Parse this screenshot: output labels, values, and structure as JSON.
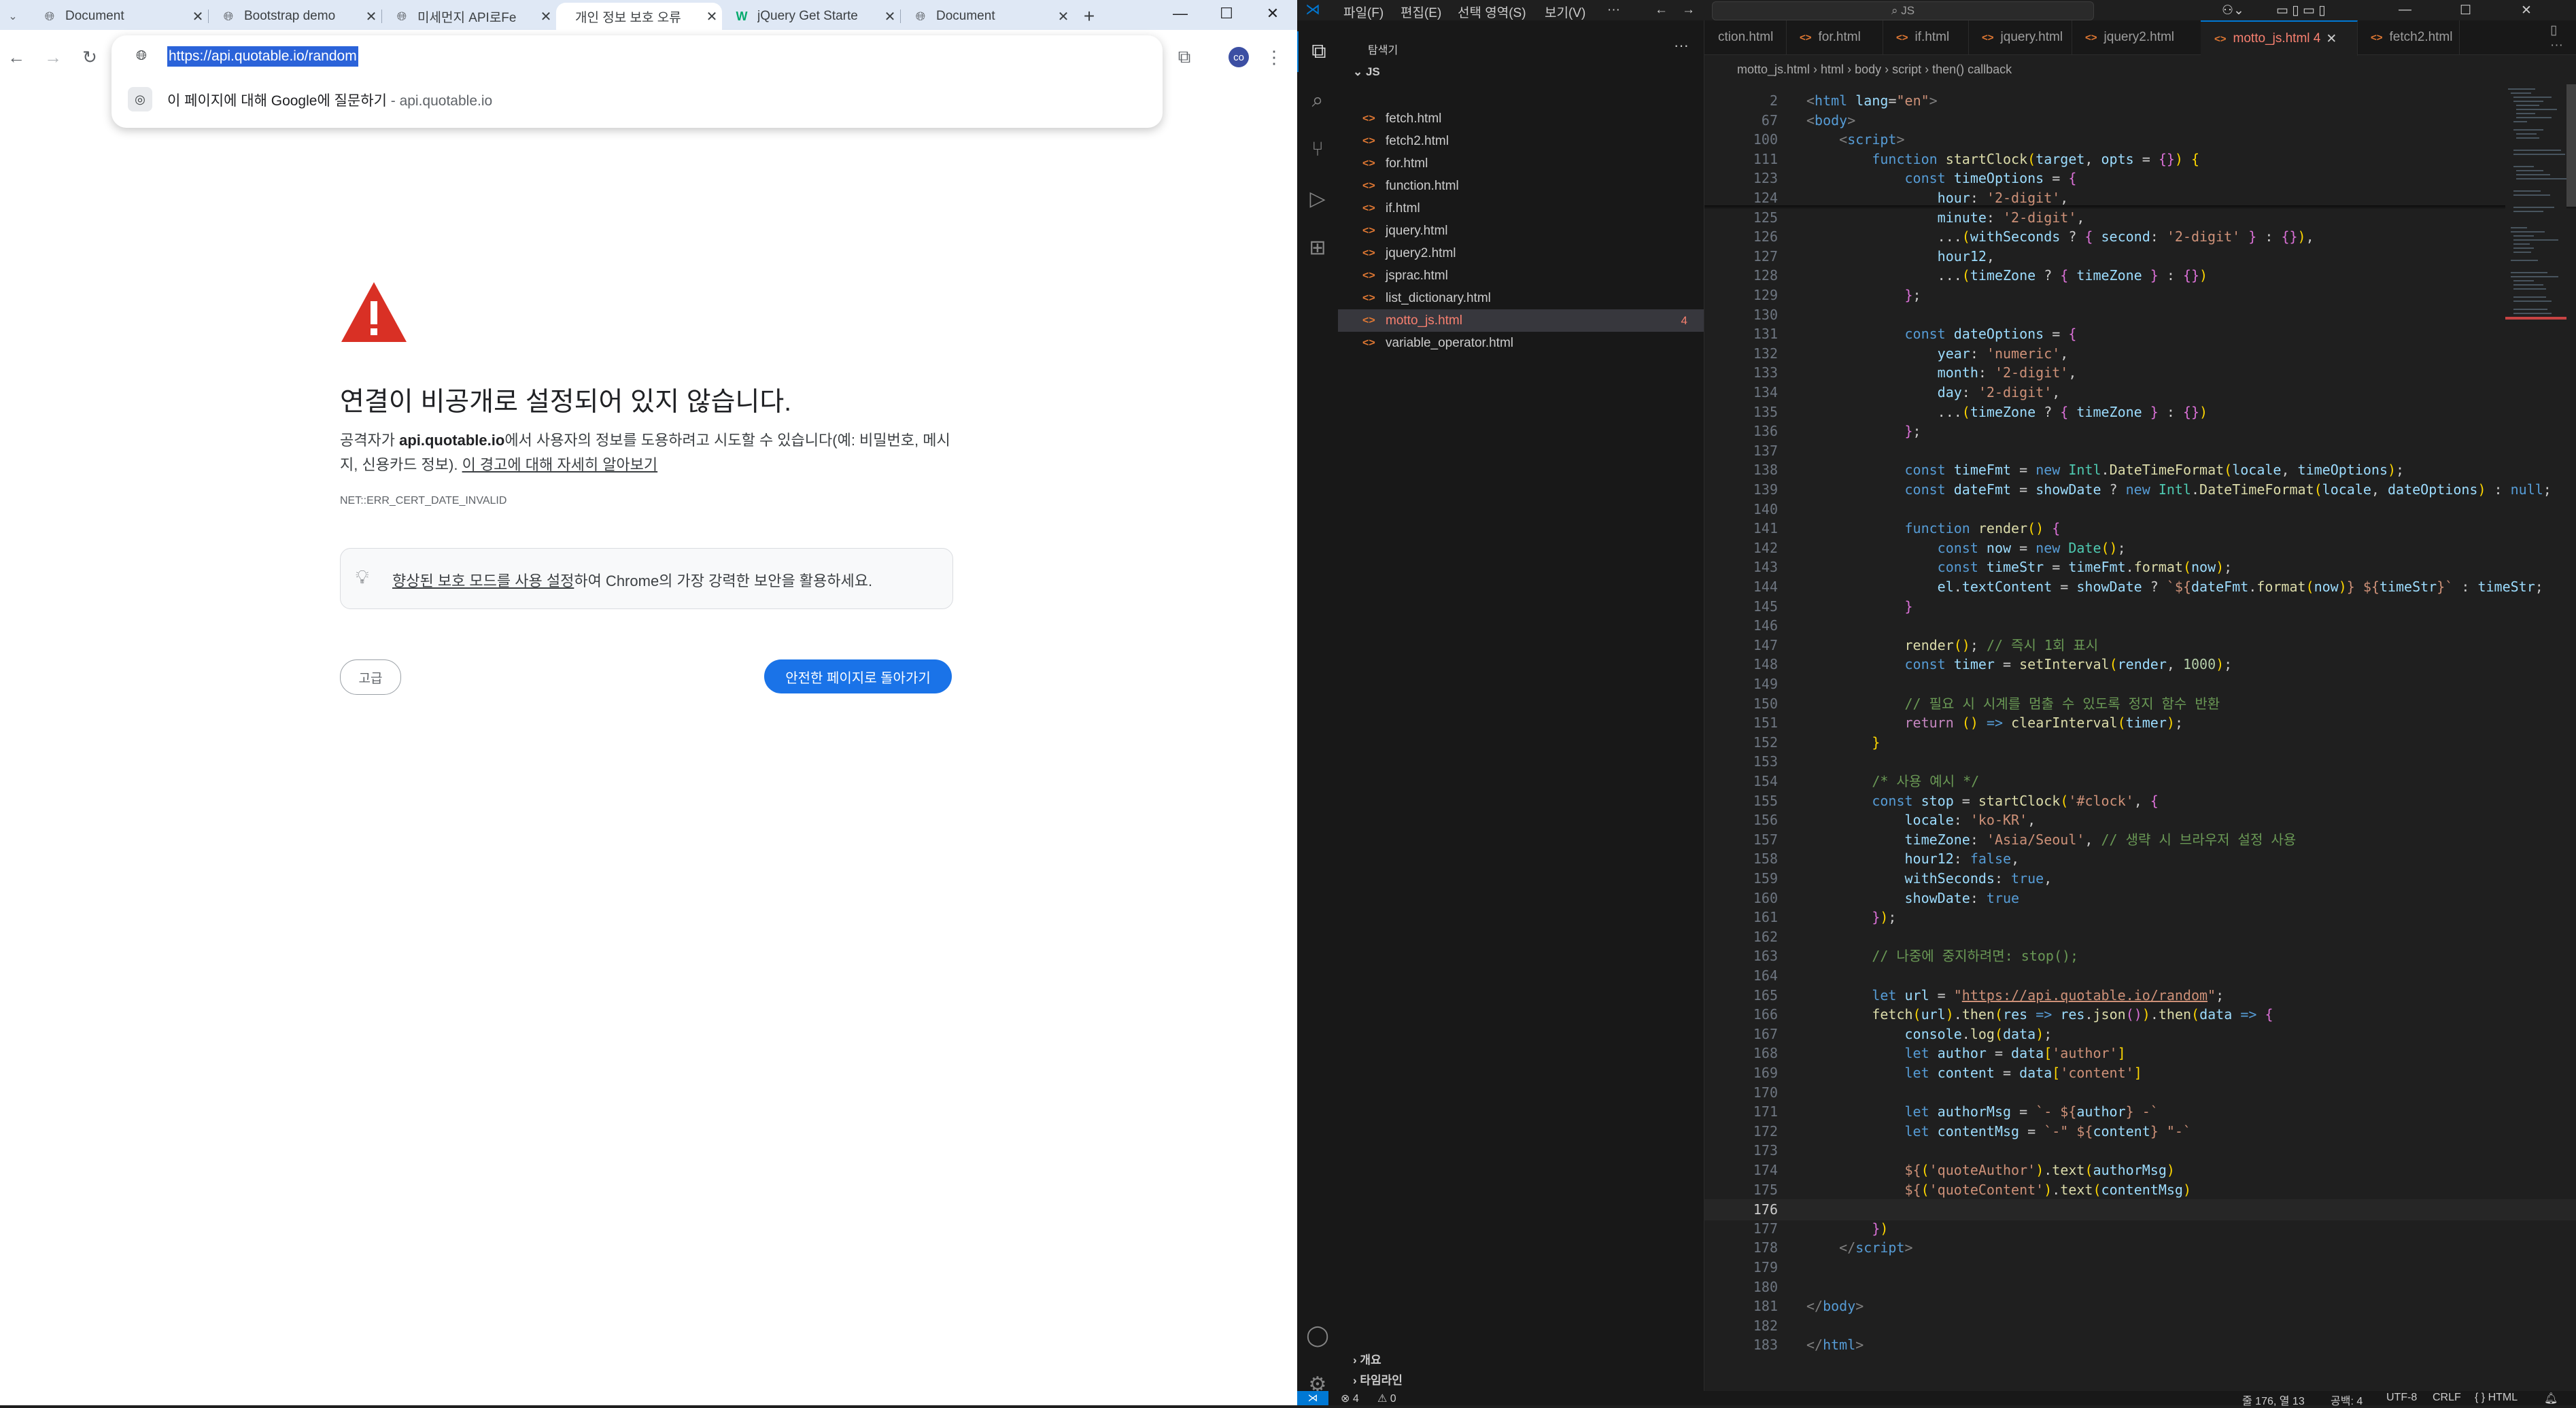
{
  "chrome": {
    "tabs": [
      {
        "title": "Document",
        "icon": "globe-icon"
      },
      {
        "title": "Bootstrap demo",
        "icon": "globe-icon"
      },
      {
        "title": "미세먼지 API로Fe",
        "icon": "globe-icon"
      },
      {
        "title": "개인 정보 보호 오류",
        "icon": "none",
        "active": true
      },
      {
        "title": "jQuery Get Starte",
        "icon": "w3-icon"
      },
      {
        "title": "Document",
        "icon": "globe-icon"
      }
    ],
    "new_tab": "+",
    "window_controls": {
      "minimize": "—",
      "maximize": "☐",
      "close": "✕"
    },
    "address_url": "https://api.quotable.io/random",
    "suggestion": {
      "text": "이 페이지에 대해 Google에 질문하기",
      "separator": " - ",
      "domain": "api.quotable.io"
    },
    "profile_initials": "co",
    "interstitial": {
      "title": "연결이 비공개로 설정되어 있지 않습니다.",
      "body_prefix": "공격자가 ",
      "body_domain": "api.quotable.io",
      "body_suffix": "에서 사용자의 정보를 도용하려고 시도할 수 있습니다(예: 비밀번호, 메시지, 신용카드 정보). ",
      "body_link": "이 경고에 대해 자세히 알아보기",
      "error_code": "NET::ERR_CERT_DATE_INVALID",
      "protect_link": "향상된 보호 모드를 사용 설정",
      "protect_rest": "하여 Chrome의 가장 강력한 보안을 활용하세요.",
      "advanced_button": "고급",
      "back_button": "안전한 페이지로 돌아가기"
    }
  },
  "vscode": {
    "menus": [
      "파일(F)",
      "편집(E)",
      "선택 영역(S)",
      "보기(V)",
      "···"
    ],
    "search_text": "JS",
    "explorer_title": "탐색기",
    "folder": "JS",
    "files": [
      {
        "name": "fetch.html"
      },
      {
        "name": "fetch2.html"
      },
      {
        "name": "for.html"
      },
      {
        "name": "function.html"
      },
      {
        "name": "if.html"
      },
      {
        "name": "jquery.html"
      },
      {
        "name": "jquery2.html"
      },
      {
        "name": "jsprac.html"
      },
      {
        "name": "list_dictionary.html"
      },
      {
        "name": "motto_js.html",
        "selected": true,
        "badge": "4"
      },
      {
        "name": "variable_operator.html"
      }
    ],
    "outline_label": "개요",
    "timeline_label": "타임라인",
    "editor_tabs": [
      {
        "name": "ction.html"
      },
      {
        "name": "for.html"
      },
      {
        "name": "if.html"
      },
      {
        "name": "jquery.html"
      },
      {
        "name": "jquery2.html"
      },
      {
        "name": "motto_js.html 4",
        "active": true
      },
      {
        "name": "fetch2.html"
      }
    ],
    "breadcrumb": [
      "motto_js.html",
      "html",
      "body",
      "script",
      "then() callback"
    ],
    "code_lines": [
      {
        "no": "2",
        "html": "<span class='g'>&lt;</span><span class='t'>html</span> <span class='a'>lang</span>=<span class='s'>\"en\"</span><span class='g'>&gt;</span>"
      },
      {
        "no": "67",
        "html": "<span class='g'>&lt;</span><span class='t'>body</span><span class='g'>&gt;</span>"
      },
      {
        "no": "100",
        "html": "    <span class='g'>&lt;</span><span class='t'>script</span><span class='g'>&gt;</span>"
      },
      {
        "no": "111",
        "html": "        <span class='k'>function</span> <span class='f'>startClock</span><span class='y'>(</span><span class='v'>target</span>, <span class='v'>opts</span> = <span class='p'>{}</span><span class='y'>)</span> <span class='y'>{</span>"
      },
      {
        "no": "123",
        "html": "            <span class='k'>const</span> <span class='v'>timeOptions</span> = <span class='p'>{</span>"
      },
      {
        "no": "124",
        "html": "                <span class='v'>hour</span>: <span class='s'>'2-digit'</span>,"
      },
      {
        "no": "125",
        "html": "                <span class='v'>minute</span>: <span class='s'>'2-digit'</span>,"
      },
      {
        "no": "126",
        "html": "                ...<span class='y'>(</span><span class='v'>withSeconds</span> ? <span class='p'>{</span> <span class='v'>second</span>: <span class='s'>'2-digit'</span> <span class='p'>}</span> : <span class='p'>{}</span><span class='y'>)</span>,"
      },
      {
        "no": "127",
        "html": "                <span class='v'>hour12</span>,"
      },
      {
        "no": "128",
        "html": "                ...<span class='y'>(</span><span class='v'>timeZone</span> ? <span class='p'>{</span> <span class='v'>timeZone</span> <span class='p'>}</span> : <span class='p'>{}</span><span class='y'>)</span>"
      },
      {
        "no": "129",
        "html": "            <span class='p'>}</span>;"
      },
      {
        "no": "130",
        "html": ""
      },
      {
        "no": "131",
        "html": "            <span class='k'>const</span> <span class='v'>dateOptions</span> = <span class='p'>{</span>"
      },
      {
        "no": "132",
        "html": "                <span class='v'>year</span>: <span class='s'>'numeric'</span>,"
      },
      {
        "no": "133",
        "html": "                <span class='v'>month</span>: <span class='s'>'2-digit'</span>,"
      },
      {
        "no": "134",
        "html": "                <span class='v'>day</span>: <span class='s'>'2-digit'</span>,"
      },
      {
        "no": "135",
        "html": "                ...<span class='y'>(</span><span class='v'>timeZone</span> ? <span class='p'>{</span> <span class='v'>timeZone</span> <span class='p'>}</span> : <span class='p'>{}</span><span class='y'>)</span>"
      },
      {
        "no": "136",
        "html": "            <span class='p'>}</span>;"
      },
      {
        "no": "137",
        "html": ""
      },
      {
        "no": "138",
        "html": "            <span class='k'>const</span> <span class='v'>timeFmt</span> = <span class='k'>new</span> <span class='cl'>Intl</span>.<span class='f'>DateTimeFormat</span><span class='y'>(</span><span class='v'>locale</span>, <span class='v'>timeOptions</span><span class='y'>)</span>;"
      },
      {
        "no": "139",
        "html": "            <span class='k'>const</span> <span class='v'>dateFmt</span> = <span class='v'>showDate</span> ? <span class='k'>new</span> <span class='cl'>Intl</span>.<span class='f'>DateTimeFormat</span><span class='y'>(</span><span class='v'>locale</span>, <span class='v'>dateOptions</span><span class='y'>)</span> : <span class='k'>null</span>;"
      },
      {
        "no": "140",
        "html": ""
      },
      {
        "no": "141",
        "html": "            <span class='k'>function</span> <span class='f'>render</span><span class='y'>()</span> <span class='p'>{</span>"
      },
      {
        "no": "142",
        "html": "                <span class='k'>const</span> <span class='v'>now</span> = <span class='k'>new</span> <span class='cl'>Date</span><span class='y'>()</span>;"
      },
      {
        "no": "143",
        "html": "                <span class='k'>const</span> <span class='v'>timeStr</span> = <span class='v'>timeFmt</span>.<span class='f'>format</span><span class='y'>(</span><span class='v'>now</span><span class='y'>)</span>;"
      },
      {
        "no": "144",
        "html": "                <span class='v'>el</span>.<span class='v'>textContent</span> = <span class='v'>showDate</span> ? <span class='s'>`${</span><span class='v'>dateFmt</span>.<span class='f'>format</span><span class='y'>(</span><span class='v'>now</span><span class='y'>)</span><span class='s'>} ${</span><span class='v'>timeStr</span><span class='s'>}`</span> : <span class='v'>timeStr</span>;"
      },
      {
        "no": "145",
        "html": "            <span class='p'>}</span>"
      },
      {
        "no": "146",
        "html": ""
      },
      {
        "no": "147",
        "html": "            <span class='f'>render</span><span class='y'>()</span>; <span class='cm'>// 즉시 1회 표시</span>"
      },
      {
        "no": "148",
        "html": "            <span class='k'>const</span> <span class='v'>timer</span> = <span class='f'>setInterval</span><span class='y'>(</span><span class='v'>render</span>, <span class='n'>1000</span><span class='y'>)</span>;"
      },
      {
        "no": "149",
        "html": ""
      },
      {
        "no": "150",
        "html": "            <span class='cm'>// 필요 시 시계를 멈출 수 있도록 정지 함수 반환</span>"
      },
      {
        "no": "151",
        "html": "            <span class='c'>return</span> <span class='y'>()</span> <span class='k'>=&gt;</span> <span class='f'>clearInterval</span><span class='y'>(</span><span class='v'>timer</span><span class='y'>)</span>;"
      },
      {
        "no": "152",
        "html": "        <span class='y'>}</span>"
      },
      {
        "no": "153",
        "html": ""
      },
      {
        "no": "154",
        "html": "        <span class='cm'>/* 사용 예시 */</span>"
      },
      {
        "no": "155",
        "html": "        <span class='k'>const</span> <span class='v'>stop</span> = <span class='f'>startClock</span><span class='y'>(</span><span class='s'>'#clock'</span>, <span class='p'>{</span>"
      },
      {
        "no": "156",
        "html": "            <span class='v'>locale</span>: <span class='s'>'ko-KR'</span>,"
      },
      {
        "no": "157",
        "html": "            <span class='v'>timeZone</span>: <span class='s'>'Asia/Seoul'</span>, <span class='cm'>// 생략 시 브라우저 설정 사용</span>"
      },
      {
        "no": "158",
        "html": "            <span class='v'>hour12</span>: <span class='k'>false</span>,"
      },
      {
        "no": "159",
        "html": "            <span class='v'>withSeconds</span>: <span class='k'>true</span>,"
      },
      {
        "no": "160",
        "html": "            <span class='v'>showDate</span>: <span class='k'>true</span>"
      },
      {
        "no": "161",
        "html": "        <span class='p'>}</span><span class='y'>)</span>;"
      },
      {
        "no": "162",
        "html": ""
      },
      {
        "no": "163",
        "html": "        <span class='cm'>// 나중에 중지하려면: stop();</span>"
      },
      {
        "no": "164",
        "html": ""
      },
      {
        "no": "165",
        "html": "        <span class='k'>let</span> <span class='v'>url</span> = <span class='s'>\"</span><span class='u'>https://api.quotable.io/random</span><span class='s'>\"</span>;"
      },
      {
        "no": "166",
        "html": "        <span class='f'>fetch</span><span class='y'>(</span><span class='v'>url</span><span class='y'>)</span>.<span class='f'>then</span><span class='y'>(</span><span class='v'>res</span> <span class='k'>=&gt;</span> <span class='v'>res</span>.<span class='f'>json</span><span class='p'>()</span><span class='y'>)</span>.<span class='f'>then</span><span class='y'>(</span><span class='v'>data</span> <span class='k'>=&gt;</span> <span class='p'>{</span>"
      },
      {
        "no": "167",
        "html": "            <span class='v'>console</span>.<span class='f'>log</span><span class='y'>(</span><span class='v'>data</span><span class='y'>)</span>;"
      },
      {
        "no": "168",
        "html": "            <span class='k'>let</span> <span class='v'>author</span> = <span class='v'>data</span><span class='y'>[</span><span class='s'>'author'</span><span class='y'>]</span>"
      },
      {
        "no": "169",
        "html": "            <span class='k'>let</span> <span class='v'>content</span> = <span class='v'>data</span><span class='y'>[</span><span class='s'>'content'</span><span class='y'>]</span>"
      },
      {
        "no": "170",
        "html": ""
      },
      {
        "no": "171",
        "html": "            <span class='k'>let</span> <span class='v'>authorMsg</span> = <span class='s'>`- ${</span><span class='v'>author</span><span class='s'>} -`</span>"
      },
      {
        "no": "172",
        "html": "            <span class='k'>let</span> <span class='v'>contentMsg</span> = <span class='s'>`-\" ${</span><span class='v'>content</span><span class='s'>} \"-`</span>"
      },
      {
        "no": "173",
        "html": ""
      },
      {
        "no": "174",
        "html": "            <span class='s'>${</span><span class='y'>(</span><span class='s'>'quoteAuthor'</span><span class='y'>)</span>.<span class='f'>text</span><span class='y'>(</span><span class='v'>authorMsg</span><span class='y'>)</span>"
      },
      {
        "no": "175",
        "html": "            <span class='s'>${</span><span class='y'>(</span><span class='s'>'quoteContent'</span><span class='y'>)</span>.<span class='f'>text</span><span class='y'>(</span><span class='v'>contentMsg</span><span class='y'>)</span>"
      },
      {
        "no": "176",
        "html": "",
        "current": true
      },
      {
        "no": "177",
        "html": "        <span class='p'>}</span><span class='y'>)</span>"
      },
      {
        "no": "178",
        "html": "    <span class='g'>&lt;/</span><span class='t'>script</span><span class='g'>&gt;</span>"
      },
      {
        "no": "179",
        "html": ""
      },
      {
        "no": "180",
        "html": ""
      },
      {
        "no": "181",
        "html": "<span class='g'>&lt;/</span><span class='t'>body</span><span class='g'>&gt;</span>"
      },
      {
        "no": "182",
        "html": ""
      },
      {
        "no": "183",
        "html": "<span class='g'>&lt;/</span><span class='t'>html</span><span class='g'>&gt;</span>"
      }
    ],
    "status": {
      "errors": "⊗ 4",
      "warnings": "⚠ 0",
      "position": "줄 176, 열 13",
      "spaces": "공백: 4",
      "encoding": "UTF-8",
      "eol": "CRLF",
      "language": "{ } HTML"
    },
    "colors": {
      "accent": "#0078d4",
      "error_file": "#f88070",
      "html_icon": "#e37933"
    }
  }
}
